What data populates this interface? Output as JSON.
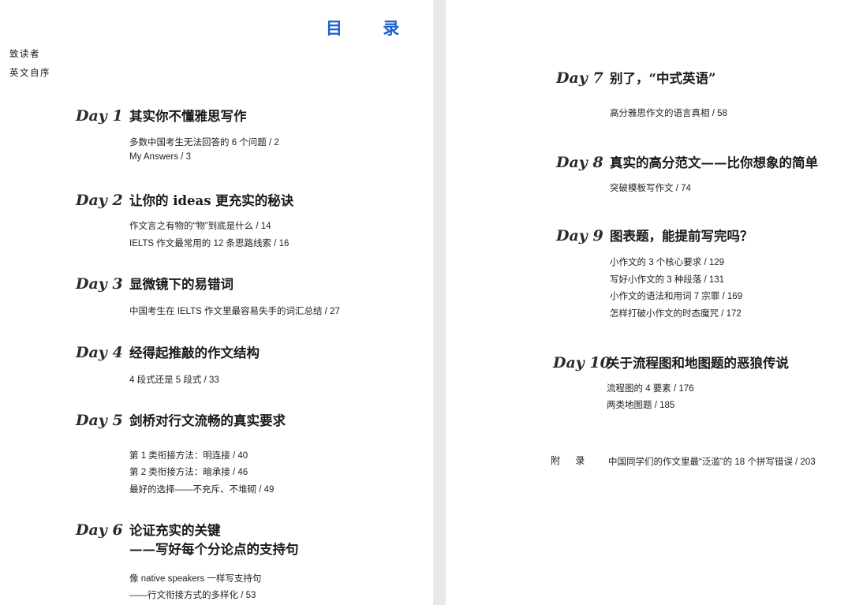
{
  "toc_title": "目 录",
  "front_matter": [
    "致读者",
    "英文自序"
  ],
  "days": [
    {
      "label": "Day 1",
      "title": [
        "其实你不懂雅思写作"
      ],
      "items": [
        "多数中国考生无法回答的 6 个问题 / 2",
        "My Answers / 3"
      ]
    },
    {
      "label": "Day 2",
      "title": [
        "让你的 ideas 更充实的秘诀"
      ],
      "items": [
        "作文言之有物的“物”到底是什么 / 14",
        "IELTS 作文最常用的 12 条思路线索 / 16"
      ]
    },
    {
      "label": "Day 3",
      "title": [
        "显微镜下的易错词"
      ],
      "items": [
        "中国考生在 IELTS 作文里最容易失手的词汇总结 / 27"
      ]
    },
    {
      "label": "Day 4",
      "title": [
        "经得起推敲的作文结构"
      ],
      "items": [
        "4 段式还是 5 段式 / 33"
      ]
    },
    {
      "label": "Day 5",
      "title": [
        "剑桥对行文流畅的真实要求"
      ],
      "items": [
        "第 1 类衔接方法：明连接 / 40",
        "第 2 类衔接方法：暗承接 / 46",
        "最好的选择——不充斥、不堆砌 / 49"
      ]
    },
    {
      "label": "Day 6",
      "title": [
        "论证充实的关键",
        "——写好每个分论点的支持句"
      ],
      "items": [
        "像 native speakers 一样写支持句",
        "——行文衔接方式的多样化 / 53"
      ]
    },
    {
      "label": "Day 7",
      "title": [
        "别了，“中式英语”"
      ],
      "items": [
        "高分雅思作文的语言真相 / 58"
      ]
    },
    {
      "label": "Day 8",
      "title": [
        "真实的高分范文——比你想象的简单"
      ],
      "items": [
        "突破模板写作文 / 74"
      ]
    },
    {
      "label": "Day 9",
      "title": [
        "图表题，能提前写完吗？"
      ],
      "items": [
        "小作文的 3 个核心要求 / 129",
        "写好小作文的 3 种段落 / 131",
        "小作文的语法和用词 7 宗罪 / 169",
        "怎样打破小作文的时态魔咒 / 172"
      ]
    },
    {
      "label": "Day 10",
      "title": [
        "关于流程图和地图题的恶狼传说"
      ],
      "items": [
        "流程图的 4 要素 / 176",
        "两类地图题 / 185"
      ]
    }
  ],
  "appendix": {
    "label": "附 录",
    "text": "中国同学们的作文里最“泛滥”的 18 个拼写错误 / 203"
  }
}
